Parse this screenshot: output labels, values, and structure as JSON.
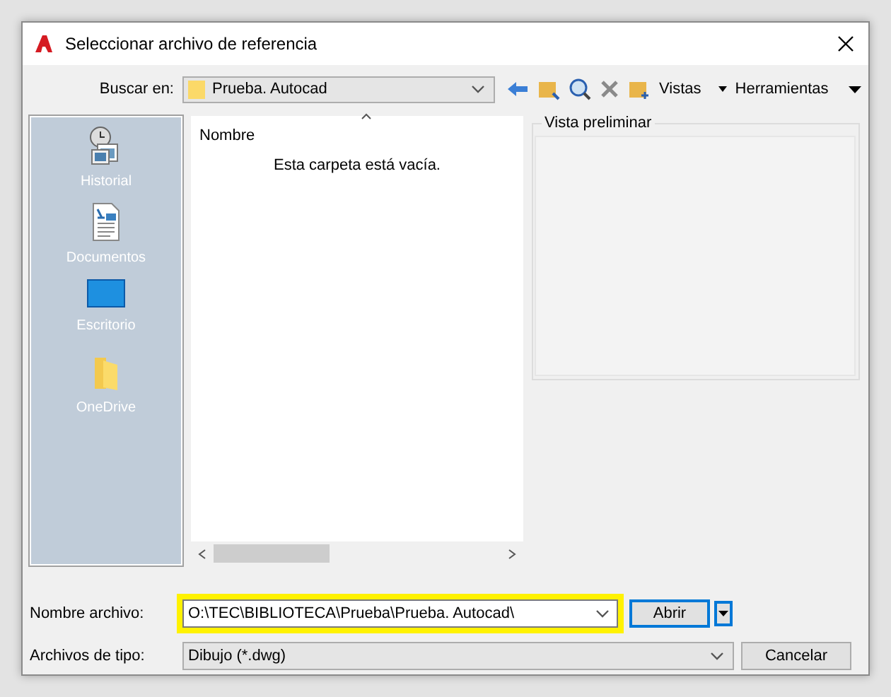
{
  "window": {
    "title": "Seleccionar archivo de referencia"
  },
  "toolbar": {
    "look_in_label": "Buscar en:",
    "look_in_value": "Prueba. Autocad",
    "views": "Vistas",
    "tools": "Herramientas"
  },
  "sidebar": {
    "items": [
      {
        "label": "Historial",
        "kind": "history"
      },
      {
        "label": "Documentos",
        "kind": "documents"
      },
      {
        "label": "Escritorio",
        "kind": "desktop"
      },
      {
        "label": "OneDrive",
        "kind": "folder"
      }
    ]
  },
  "file_list": {
    "column": "Nombre",
    "empty_message": "Esta carpeta está vacía."
  },
  "preview": {
    "title": "Vista preliminar"
  },
  "file_name": {
    "label": "Nombre archivo:",
    "value": "O:\\TEC\\BIBLIOTECA\\Prueba\\Prueba. Autocad\\"
  },
  "file_type": {
    "label": "Archivos de tipo:",
    "value": "Dibujo (*.dwg)"
  },
  "buttons": {
    "open": "Abrir",
    "cancel": "Cancelar"
  }
}
